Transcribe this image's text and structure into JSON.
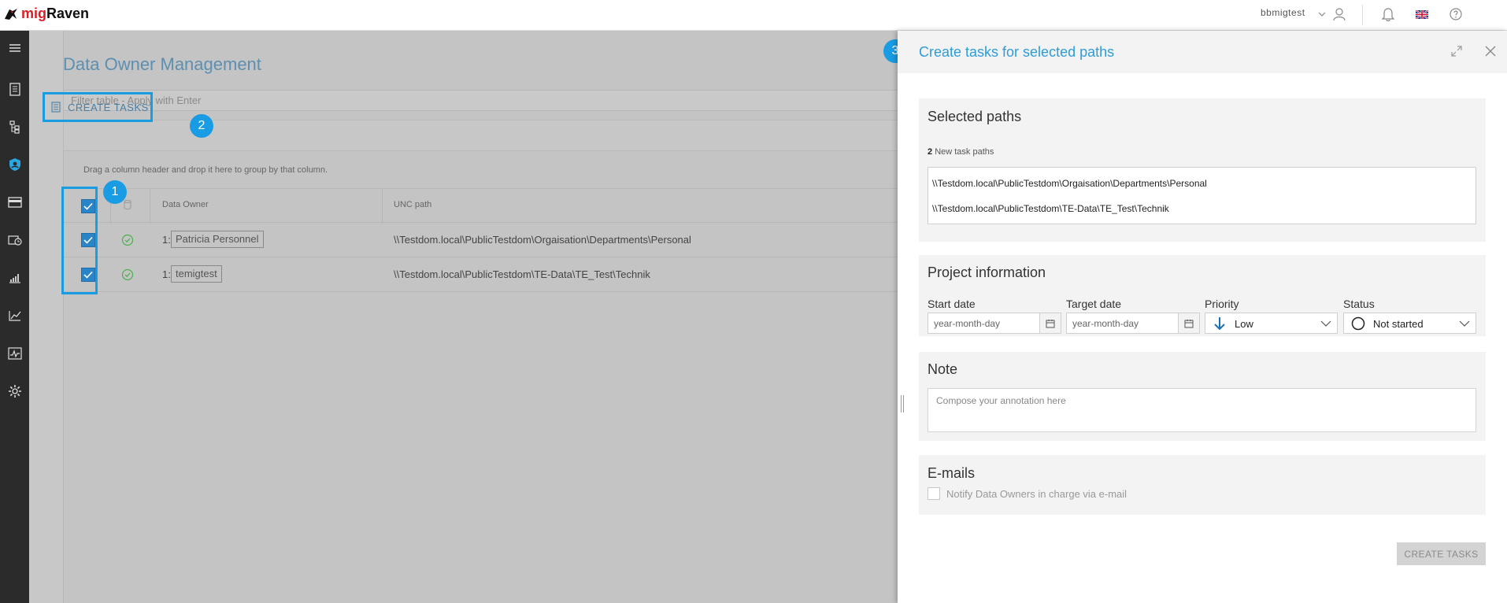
{
  "app": {
    "logo_prefix": "mig",
    "logo_suffix": "Raven"
  },
  "header": {
    "username": "bbmigtest",
    "language": "English (UK)"
  },
  "main": {
    "page_title": "Data Owner Management",
    "filter_placeholder": "Filter table - Apply with Enter",
    "create_tasks_label": "CREATE TASKS",
    "group_hint": "Drag a column header and drop it here to group by that column.",
    "columns": {
      "owner": "Data Owner",
      "unc": "UNC path"
    },
    "rows": [
      {
        "index": "1:",
        "owner": "Patricia Personnel",
        "path": "\\\\Testdom.local\\PublicTestdom\\Orgaisation\\Departments\\Personal"
      },
      {
        "index": "1:",
        "owner": "temigtest",
        "path": "\\\\Testdom.local\\PublicTestdom\\TE-Data\\TE_Test\\Technik"
      }
    ],
    "badges": [
      "1",
      "2",
      "3"
    ]
  },
  "panel": {
    "title": "Create tasks for selected paths",
    "selected_paths": {
      "title": "Selected paths",
      "count": "2",
      "count_label": "New task paths",
      "paths": [
        "\\\\Testdom.local\\PublicTestdom\\Orgaisation\\Departments\\Personal",
        "\\\\Testdom.local\\PublicTestdom\\TE-Data\\TE_Test\\Technik"
      ]
    },
    "project": {
      "title": "Project information",
      "start_label": "Start date",
      "start_placeholder": "year-month-day",
      "target_label": "Target date",
      "target_placeholder": "year-month-day",
      "priority_label": "Priority",
      "priority_value": "Low",
      "status_label": "Status",
      "status_value": "Not started"
    },
    "note": {
      "title": "Note",
      "placeholder": "Compose your annotation here"
    },
    "emails": {
      "title": "E-mails",
      "notify_label": "Notify Data Owners in charge via e-mail"
    },
    "submit_label": "CREATE TASKS"
  },
  "colors": {
    "accent": "#1a9ce4",
    "title_blue": "#2d9cd8",
    "sidebar": "#2b2b2b",
    "logo_red": "#d62027"
  }
}
